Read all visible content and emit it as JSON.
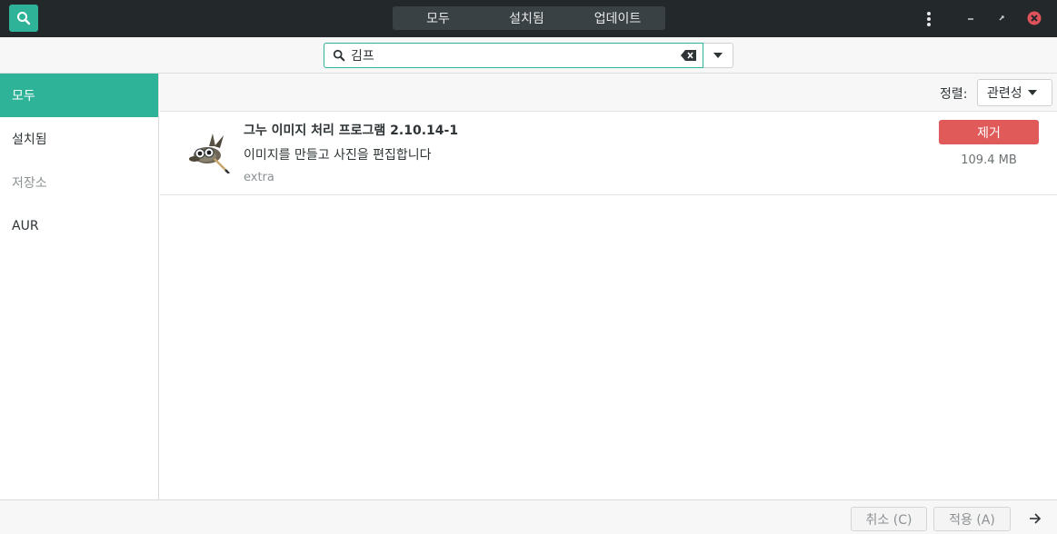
{
  "header": {
    "tabs": [
      {
        "label": "모두"
      },
      {
        "label": "설치됨"
      },
      {
        "label": "업데이트"
      }
    ],
    "icons": {
      "search": "search-icon",
      "menu": "vertical-dots-icon",
      "minimize": "minimize-icon",
      "maximize": "maximize-icon",
      "close": "close-icon"
    },
    "colors": {
      "accent": "#2eb398",
      "close": "#e0525a"
    }
  },
  "search": {
    "value": "김프",
    "clear_icon": "backspace-clear-icon",
    "dropdown_icon": "chevron-down-icon"
  },
  "sidebar": {
    "items": [
      {
        "label": "모두",
        "active": true
      },
      {
        "label": "설치됨"
      },
      {
        "label": "저장소"
      },
      {
        "label": "AUR"
      }
    ]
  },
  "sort": {
    "label": "정렬:",
    "value": "관련성"
  },
  "packages": [
    {
      "name": "그누 이미지 처리 프로그램  2.10.14-1",
      "description": "이미지를 만들고 사진을 편집합니다",
      "repo": "extra",
      "action_label": "제거",
      "size": "109.4 MB",
      "icon": "gimp-wilber-icon"
    }
  ],
  "footer": {
    "cancel_label": "취소 (C)",
    "apply_label": "적용 (A)",
    "next_icon": "arrow-right-icon"
  }
}
